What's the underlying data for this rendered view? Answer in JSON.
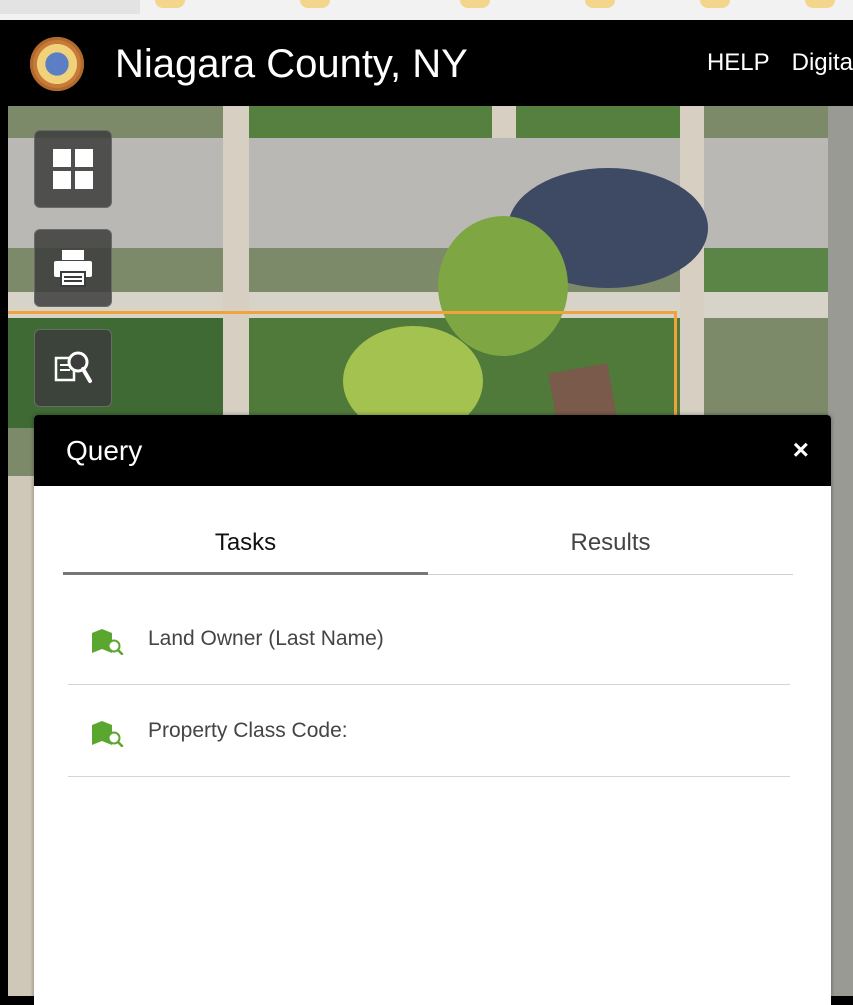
{
  "header": {
    "title": "Niagara County, NY",
    "nav": [
      "HELP",
      "Digita"
    ]
  },
  "tools": [
    {
      "name": "apps-grid-icon"
    },
    {
      "name": "print-icon"
    },
    {
      "name": "query-icon"
    }
  ],
  "panel": {
    "title": "Query",
    "close_label": "×",
    "tabs": [
      {
        "label": "Tasks",
        "active": true
      },
      {
        "label": "Results",
        "active": false
      }
    ],
    "tasks": [
      {
        "label": "Land Owner (Last Name)"
      },
      {
        "label": "Property Class Code:"
      }
    ]
  },
  "colors": {
    "header_bg": "#000000",
    "task_icon": "#5aa72f",
    "parcel_outline": "#f0a33a"
  }
}
